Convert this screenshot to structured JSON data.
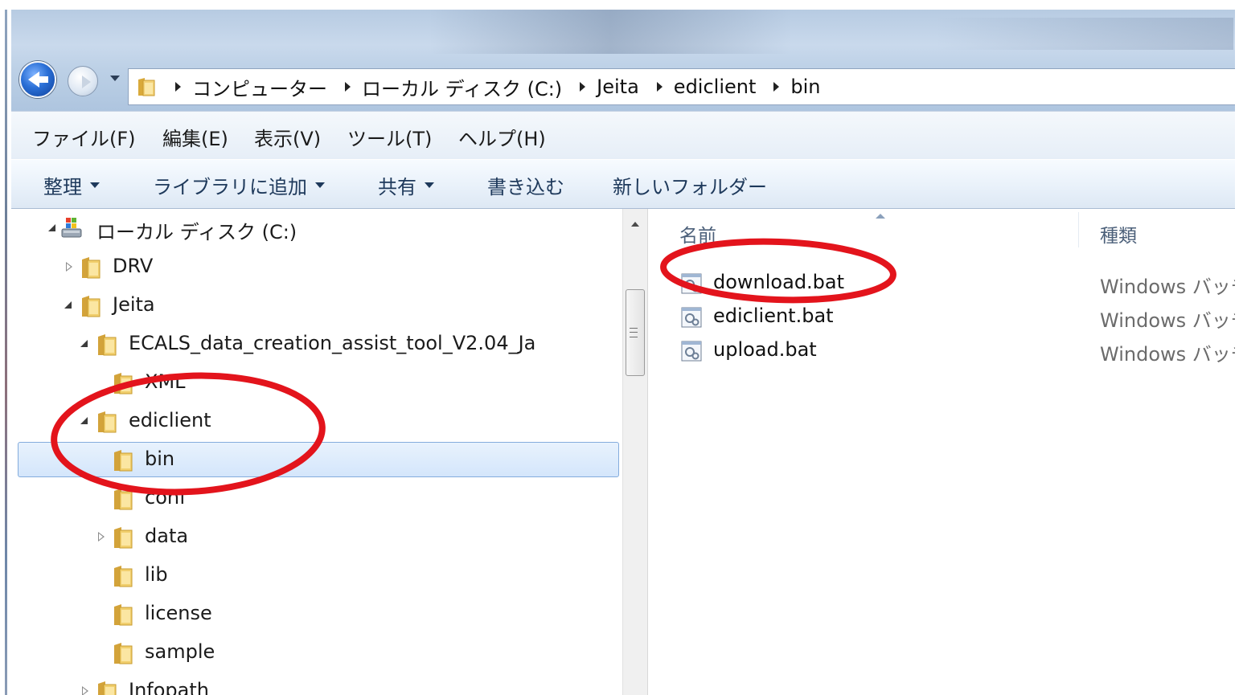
{
  "address": {
    "crumbs": [
      "コンピューター",
      "ローカル ディスク (C:)",
      "Jeita",
      "ediclient",
      "bin"
    ]
  },
  "menu": {
    "file": "ファイル(F)",
    "edit": "編集(E)",
    "view": "表示(V)",
    "tools": "ツール(T)",
    "help": "ヘルプ(H)"
  },
  "toolbar": {
    "organize": "整理",
    "add_to_library": "ライブラリに追加",
    "share": "共有",
    "burn": "書き込む",
    "new_folder": "新しいフォルダー"
  },
  "tree": {
    "drive": "ローカル ディスク (C:)",
    "items": [
      {
        "label": "DRV"
      },
      {
        "label": "Jeita"
      },
      {
        "label": "ECALS_data_creation_assist_tool_V2.04_Ja"
      },
      {
        "label": "XML"
      },
      {
        "label": "ediclient"
      },
      {
        "label": "bin"
      },
      {
        "label": "conf"
      },
      {
        "label": "data"
      },
      {
        "label": "lib"
      },
      {
        "label": "license"
      },
      {
        "label": "sample"
      },
      {
        "label": "Infopath"
      }
    ],
    "selected": "bin"
  },
  "file_list": {
    "columns": {
      "name": "名前",
      "type": "種類"
    },
    "files": [
      {
        "name": "download.bat",
        "type": "Windows バッチ"
      },
      {
        "name": "ediclient.bat",
        "type": "Windows バッチ"
      },
      {
        "name": "upload.bat",
        "type": "Windows バッチ"
      }
    ]
  },
  "colors": {
    "annotation_circle": "#e3141c",
    "selection": "#d4e6fb",
    "folder": "#e7c25a"
  }
}
